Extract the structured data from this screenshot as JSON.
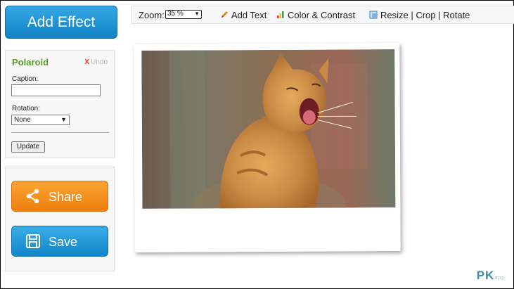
{
  "sidebar": {
    "add_effect_label": "Add Effect",
    "effect_panel": {
      "title": "Polaroid",
      "undo_x": "X",
      "undo_label": "Undo",
      "caption_label": "Caption:",
      "caption_value": "",
      "rotation_label": "Rotation:",
      "rotation_value": "None",
      "update_label": "Update"
    },
    "share_label": "Share",
    "save_label": "Save"
  },
  "toolbar": {
    "zoom_label": "Zoom:",
    "zoom_value": "35 %",
    "add_text_label": "Add Text",
    "color_contrast_label": "Color & Contrast",
    "resize_crop_rotate_label": "Resize | Crop | Rotate"
  },
  "watermark": {
    "brand": "PK",
    "sub": "app"
  },
  "colors": {
    "add_effect_blue": "#1f96d8",
    "share_orange": "#f39019",
    "save_blue": "#1c96d8",
    "panel_title_green": "#5a9a2a"
  },
  "icons": {
    "add_text": "pencil-icon",
    "color_contrast": "color-bars-icon",
    "resize": "resize-icon",
    "share": "share-icon",
    "save": "floppy-disk-icon"
  }
}
